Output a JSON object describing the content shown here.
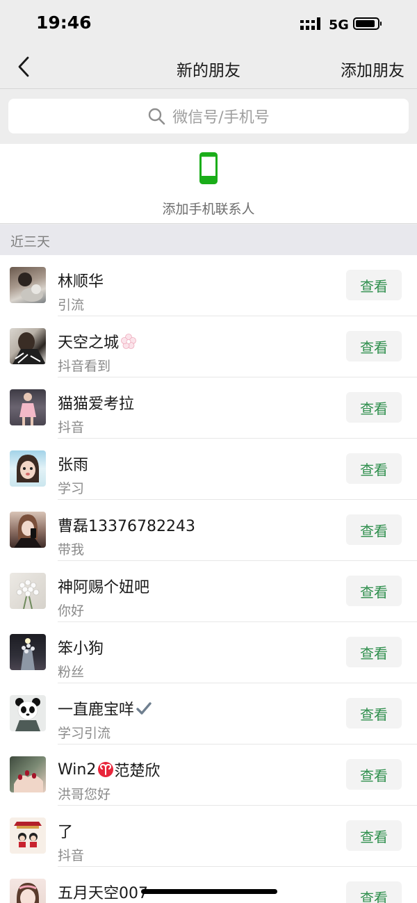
{
  "status_bar": {
    "time": "19:46",
    "network": "5G"
  },
  "nav": {
    "title": "新的朋友",
    "add_friend": "添加朋友"
  },
  "search": {
    "placeholder": "微信号/手机号"
  },
  "phone_contacts": {
    "label": "添加手机联系人"
  },
  "section": {
    "label": "近三天"
  },
  "colors": {
    "accent_green": "#2f8f4d",
    "phone_green": "#1aad19",
    "background": "#ededed"
  },
  "friends": [
    {
      "name": "林顺华",
      "message": "引流",
      "action": "查看"
    },
    {
      "name": "天空之城",
      "message": "抖音看到",
      "action": "查看",
      "emoji": "flower-icon"
    },
    {
      "name": "猫猫爱考拉",
      "message": "抖音",
      "action": "查看"
    },
    {
      "name": "张雨",
      "message": "学习",
      "action": "查看"
    },
    {
      "name": "曹磊13376782243",
      "message": "带我",
      "action": "查看"
    },
    {
      "name": "神阿赐个妞吧",
      "message": "你好",
      "action": "查看"
    },
    {
      "name": "笨小狗",
      "message": "粉丝",
      "action": "查看"
    },
    {
      "name": "一直鹿宝咩",
      "message": "学习引流",
      "action": "查看",
      "emoji": "check-icon"
    },
    {
      "name": "Win2",
      "name_suffix": "范楚欣",
      "message": "洪哥您好",
      "action": "查看",
      "emoji": "aries-icon"
    },
    {
      "name": "了",
      "message": "抖音",
      "action": "查看"
    },
    {
      "name": "五月天空007",
      "message": "",
      "action": "查看"
    }
  ]
}
